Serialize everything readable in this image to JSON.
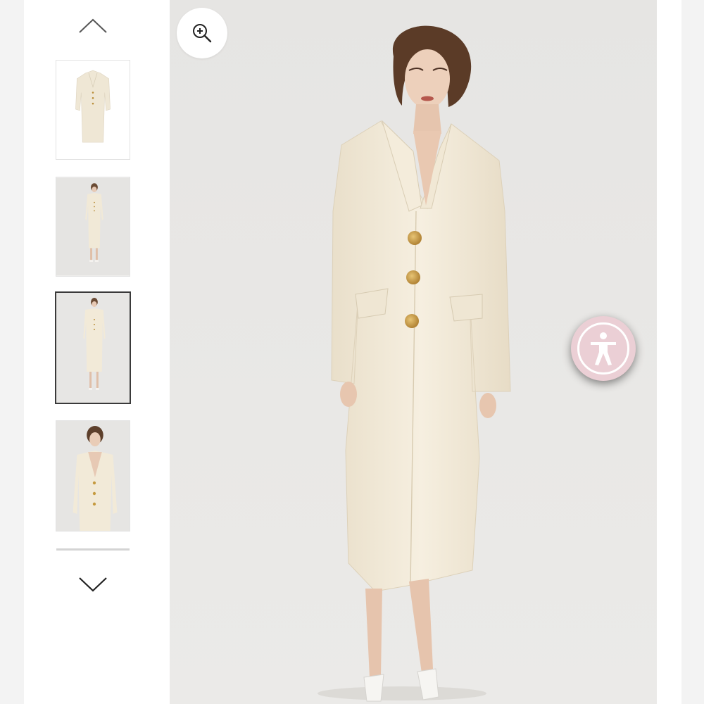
{
  "gallery": {
    "prev_icon": "chevron-up-icon",
    "next_icon": "chevron-down-icon",
    "thumbnails": [
      {
        "kind": "product-flat-lay",
        "active": false
      },
      {
        "kind": "model-full-front",
        "active": false
      },
      {
        "kind": "model-full-front-alt",
        "active": true
      },
      {
        "kind": "model-close-up",
        "active": false
      }
    ],
    "active_index": 2
  },
  "main_image": {
    "subject": "model-in-cream-long-coat",
    "zoom_icon": "zoom-in-icon"
  },
  "accessibility": {
    "icon": "accessibility-person-icon"
  },
  "colors": {
    "coat": "#f2ead8",
    "button_gold": "#c59a3f",
    "accessibility_bg": "#ebcfd5",
    "active_border": "#3a3a3a"
  }
}
